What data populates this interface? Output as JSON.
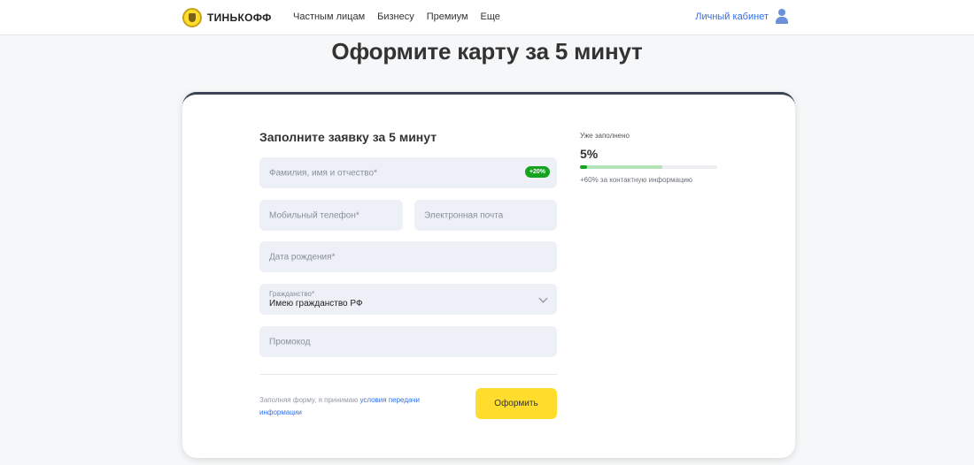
{
  "header": {
    "logo_text": "ТИНЬКОФФ",
    "nav": [
      "Частным лицам",
      "Бизнесу",
      "Премиум",
      "Еще"
    ],
    "account_label": "Личный кабинет"
  },
  "page_title": "Оформите карту за 5 минут",
  "form": {
    "title": "Заполните заявку за 5 минут",
    "full_name": {
      "placeholder": "Фамилия, имя и отчество*",
      "badge": "+20%"
    },
    "phone": {
      "placeholder": "Мобильный телефон*"
    },
    "email": {
      "placeholder": "Электронная почта"
    },
    "birth_date": {
      "placeholder": "Дата рождения*"
    },
    "citizenship": {
      "label": "Гражданство*",
      "value": "Имею гражданство РФ"
    },
    "promo": {
      "placeholder": "Промокод"
    },
    "consent_prefix": "Заполняя форму, я принимаю ",
    "consent_link": "условия передачи информации",
    "submit_label": "Оформить"
  },
  "progress": {
    "label": "Уже заполнено",
    "value_text": "5%",
    "fill_fraction": 0.05,
    "hint_fraction": 0.6,
    "note": "+60% за контактную информацию"
  },
  "colors": {
    "accent_yellow": "#ffdd2d",
    "link_blue": "#336fee",
    "success_green": "#16a31f",
    "field_bg": "#edf0f6"
  }
}
